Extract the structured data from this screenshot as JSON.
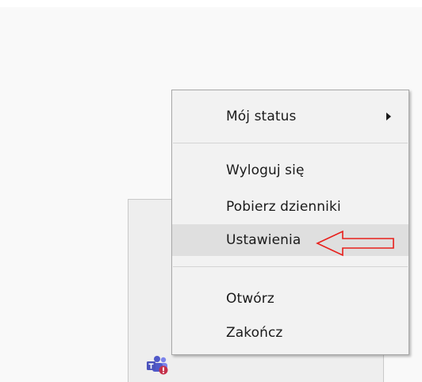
{
  "context_menu": {
    "items": [
      {
        "label": "Mój status",
        "has_submenu": true
      },
      {
        "label": "Wyloguj się"
      },
      {
        "label": "Pobierz dzienniki"
      },
      {
        "label": "Ustawienia",
        "highlighted": true
      },
      {
        "label": "Otwórz"
      },
      {
        "label": "Zakończ"
      }
    ]
  },
  "annotation": {
    "color": "#e8201c"
  },
  "tray": {
    "icon": "teams-icon"
  }
}
